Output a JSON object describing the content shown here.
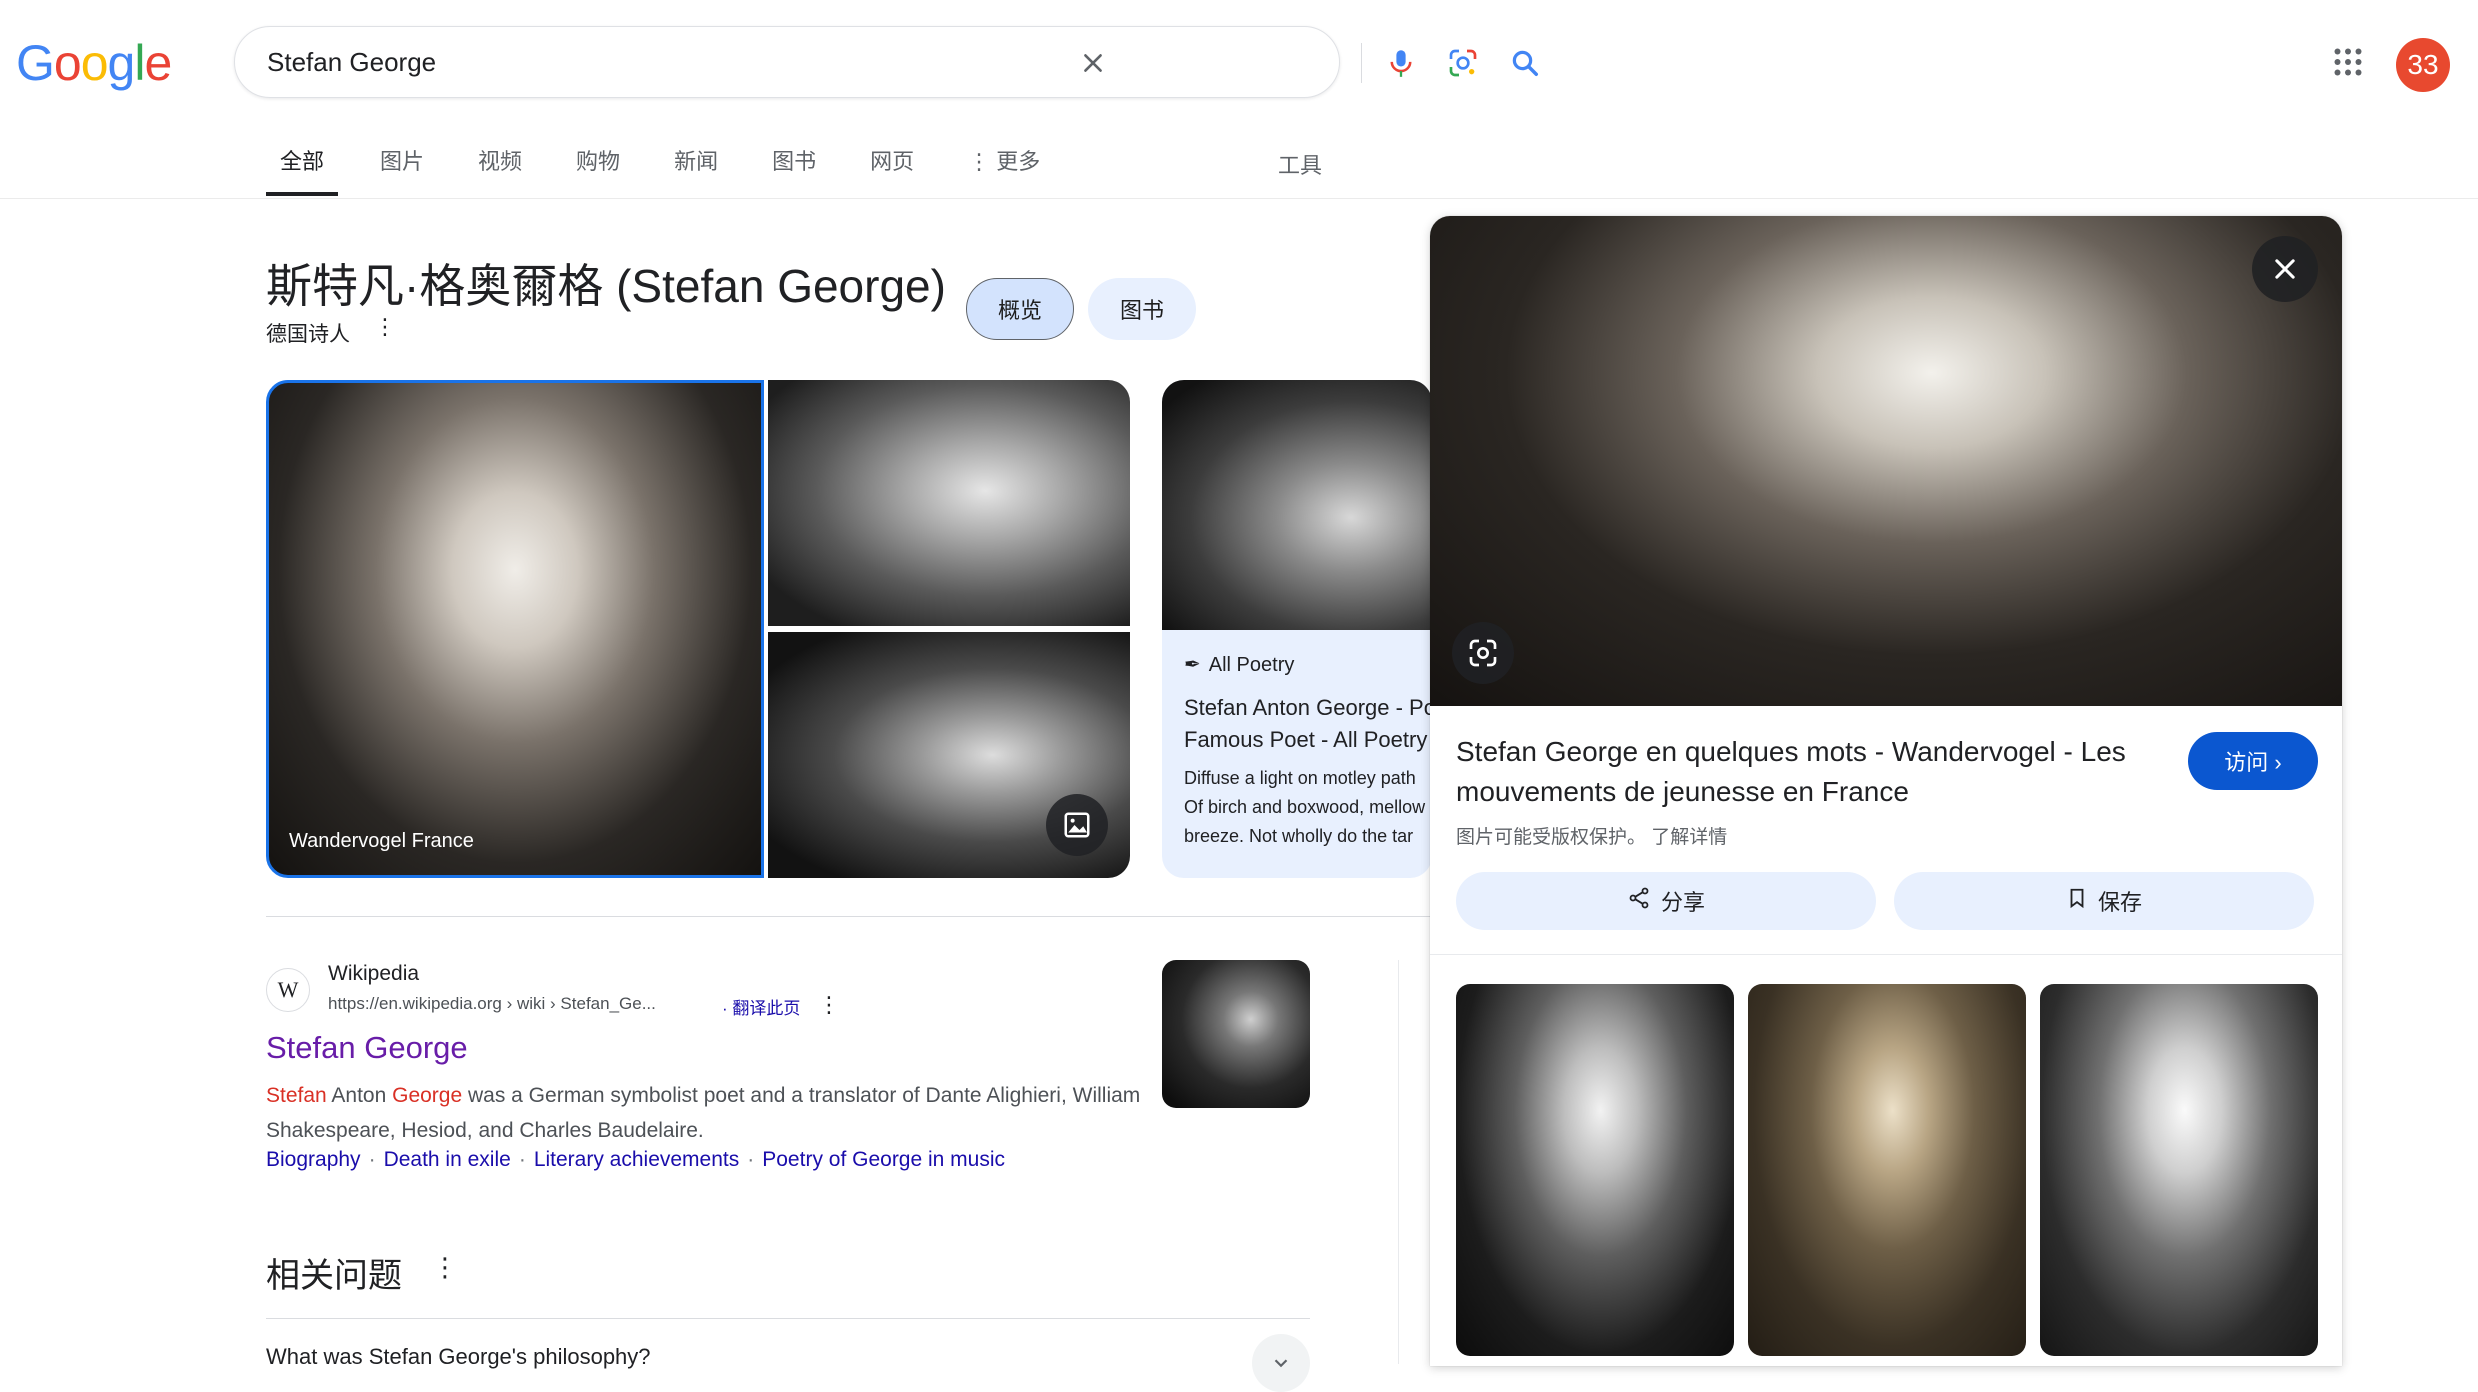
{
  "header": {
    "logo_letters": [
      {
        "ch": "G",
        "color": "#4285F4"
      },
      {
        "ch": "o",
        "color": "#EA4335"
      },
      {
        "ch": "o",
        "color": "#FBBC05"
      },
      {
        "ch": "g",
        "color": "#4285F4"
      },
      {
        "ch": "l",
        "color": "#34A853"
      },
      {
        "ch": "e",
        "color": "#EA4335"
      }
    ],
    "search_value": "Stefan George",
    "avatar_text": "33"
  },
  "tabs": {
    "items": [
      "全部",
      "图片",
      "视频",
      "购物",
      "新闻",
      "图书",
      "网页",
      "⋮ 更多"
    ],
    "active": "全部",
    "tools": "工具"
  },
  "knowledge_panel": {
    "title": "斯特凡·格奥爾格 (Stefan George)",
    "subtitle": "德国诗人",
    "pill_overview": "概览",
    "pill_books": "图书",
    "main_image_caption": "Wandervogel France"
  },
  "poetry_card": {
    "source": "All Poetry",
    "title_line1": "Stefan Anton George - Po",
    "title_line2": "Famous Poet - All Poetry",
    "desc_line1": "Diffuse a light on motley path",
    "desc_line2": "Of birch and boxwood, mellow",
    "desc_line3": "breeze. Not wholly do the tar"
  },
  "wiki_result": {
    "site": "Wikipedia",
    "url": "https://en.wikipedia.org › wiki › Stefan_Ge...",
    "translate": "· 翻译此页",
    "title": "Stefan George",
    "snippet_hl1": "Stefan",
    "snippet_mid1": " Anton ",
    "snippet_hl2": "George",
    "snippet_rest": " was a German symbolist poet and a translator of Dante Alighieri, William Shakespeare, Hesiod, and Charles Baudelaire.",
    "links": [
      "Biography",
      "Death in exile",
      "Literary achievements",
      "Poetry of George in music"
    ]
  },
  "related_questions": {
    "title": "相关问题",
    "q1": "What was Stefan George's philosophy?"
  },
  "preview_panel": {
    "title": "Stefan George en quelques mots - Wandervogel - Les mouvements de jeunesse en France",
    "visit_label": "访问 ›",
    "copyright": "图片可能受版权保护。 了解详情",
    "share_label": "分享",
    "save_label": "保存"
  },
  "colors": {
    "accent_blue": "#0b57d0",
    "link_blue": "#1a0dab",
    "visited_purple": "#681da8",
    "highlight_red": "#d93025",
    "avatar_bg": "#e8492f"
  }
}
